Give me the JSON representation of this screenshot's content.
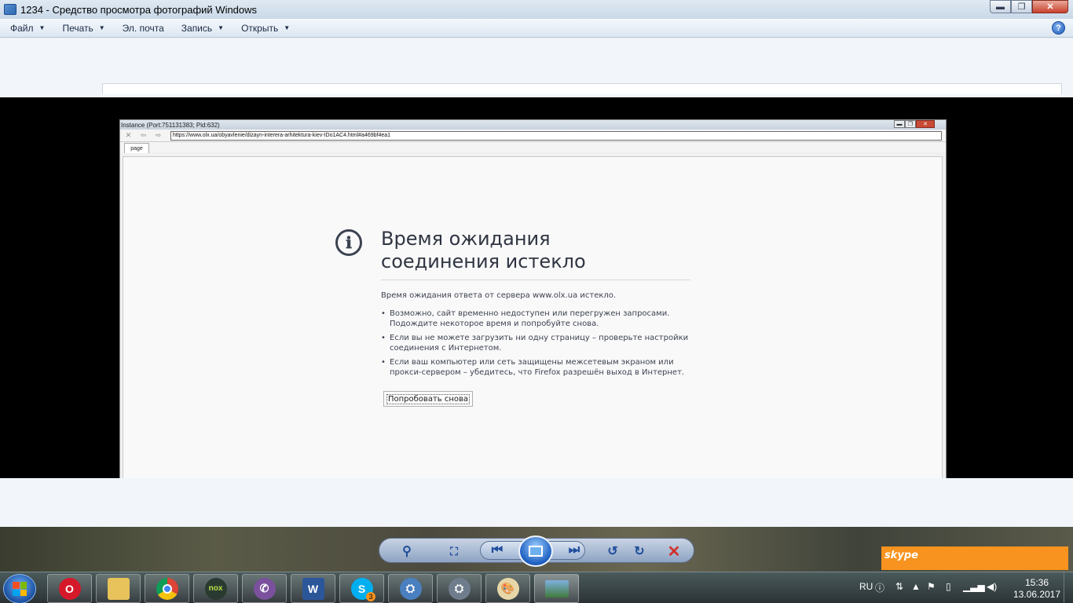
{
  "window": {
    "title": "1234 - Средство просмотра фотографий Windows",
    "min_symbol": "▬",
    "max_symbol": "❐",
    "close_symbol": "✕"
  },
  "menu": [
    {
      "label": "Файл",
      "has_caret": true
    },
    {
      "label": "Печать",
      "has_caret": true
    },
    {
      "label": "Эл. почта",
      "has_caret": false
    },
    {
      "label": "Запись",
      "has_caret": true
    },
    {
      "label": "Открыть",
      "has_caret": true
    }
  ],
  "help_symbol": "?",
  "inner_browser": {
    "title": "Instance (Port:751131383; Pid:632)",
    "url": "https://www.olx.ua/obyavlenie/dizayn-interera-arhitektura-kiev-IDo1AC4.html#a469bf4ea1",
    "tab": "page"
  },
  "error_page": {
    "icon": "ℹ",
    "title_line1": "Время ожидания",
    "title_line2": "соединения истекло",
    "description": "Время ожидания ответа от сервера www.olx.ua истекло.",
    "bullets": [
      "Возможно, сайт временно недоступен или перегружен запросами. Подождите некоторое время и попробуйте снова.",
      "Если вы не можете загрузить ни одну страницу – проверьте настройки соединения с Интернетом.",
      "Если ваш компьютер или сеть защищены межсетевым экраном или прокси-сервером – убедитесь, что Firefox разрешён выход в Интернет."
    ],
    "retry_button": "Попробовать снова"
  },
  "viewer_controls": {
    "zoom_icon": "⚲",
    "fit_icon": "⛶",
    "prev_icon": "⏮",
    "next_icon": "⏭",
    "rotate_left_icon": "↺",
    "rotate_right_icon": "↻",
    "delete_icon": "✕"
  },
  "skype_label": "skype",
  "taskbar": {
    "apps": [
      "opera",
      "file-explorer",
      "chrome",
      "nox",
      "viber",
      "word",
      "skype",
      "network-app-1",
      "network-app-2",
      "paint",
      "photo-viewer"
    ],
    "skype_badge": "3"
  },
  "tray": {
    "language": "RU",
    "time": "15:36",
    "date": "13.06.2017"
  },
  "colors": {
    "accent": "#1f5cb8",
    "skype_orange": "#f7931e",
    "close_red": "#c8412c"
  }
}
